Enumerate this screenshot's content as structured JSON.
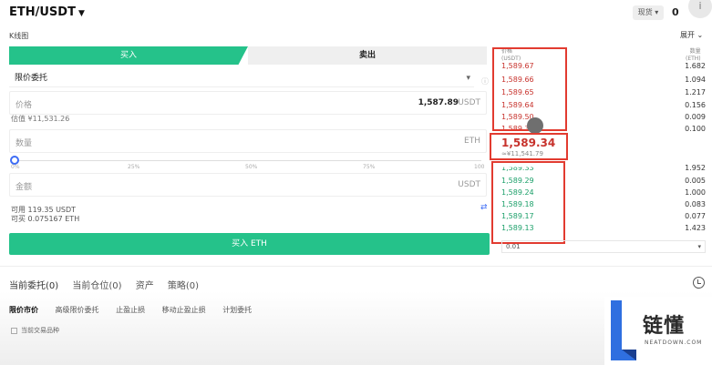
{
  "header": {
    "pair": "ETH/USDT",
    "market_type": "现货",
    "right_text": "0",
    "info_icon": "i"
  },
  "kline": {
    "label": "K线图",
    "expand": "展开"
  },
  "trade_tabs": {
    "buy": "买入",
    "sell": "卖出"
  },
  "order_type": {
    "value": "限价委托"
  },
  "price_field": {
    "label": "价格",
    "value": "1,587.89",
    "unit": "USDT"
  },
  "estimate": "估值 ¥11,531.26",
  "amount_field": {
    "label": "数量",
    "unit": "ETH"
  },
  "slider": {
    "ticks": [
      "0%",
      "25%",
      "50%",
      "75%",
      "100"
    ],
    "level_percent": 0
  },
  "total_field": {
    "label": "金额",
    "unit": "USDT"
  },
  "available": {
    "usdt": "可用 119.35 USDT",
    "eth": "可买 0.075167 ETH"
  },
  "buy_button": "买入 ETH",
  "orderbook": {
    "price_header": "价格\n(USDT)",
    "qty_header": "数量\n(ETH)",
    "asks": [
      {
        "price": "1,589.67",
        "qty": "1.682"
      },
      {
        "price": "1,589.66",
        "qty": "1.094"
      },
      {
        "price": "1,589.65",
        "qty": "1.217"
      },
      {
        "price": "1,589.64",
        "qty": "0.156"
      },
      {
        "price": "1,589.50",
        "qty": "0.009"
      },
      {
        "price": "1,589.34",
        "qty": "0.100"
      }
    ],
    "mid_price": "1,589.34",
    "mid_cny": "≈¥11,541.79",
    "bids": [
      {
        "price": "1,589.33",
        "qty": "1.952"
      },
      {
        "price": "1,589.29",
        "qty": "0.005"
      },
      {
        "price": "1,589.24",
        "qty": "1.000"
      },
      {
        "price": "1,589.18",
        "qty": "0.083"
      },
      {
        "price": "1,589.17",
        "qty": "0.077"
      },
      {
        "price": "1,589.13",
        "qty": "1.423"
      }
    ],
    "depth": "0.01"
  },
  "bottom_tabs": [
    "当前委托(0)",
    "当前仓位(0)",
    "资产",
    "策略(0)"
  ],
  "order_filters": [
    "限价市价",
    "高级限价委托",
    "止盈止损",
    "移动止盈止损",
    "计划委托"
  ],
  "checkbox_label": "当前交易品种",
  "logo": {
    "cn": "链懂",
    "en": "NEATDOWN.COM"
  },
  "colors": {
    "buy_green": "#25c28a",
    "ask_red": "#c7322c",
    "bid_green": "#1ca06a",
    "highlight_red": "#e23b30"
  }
}
